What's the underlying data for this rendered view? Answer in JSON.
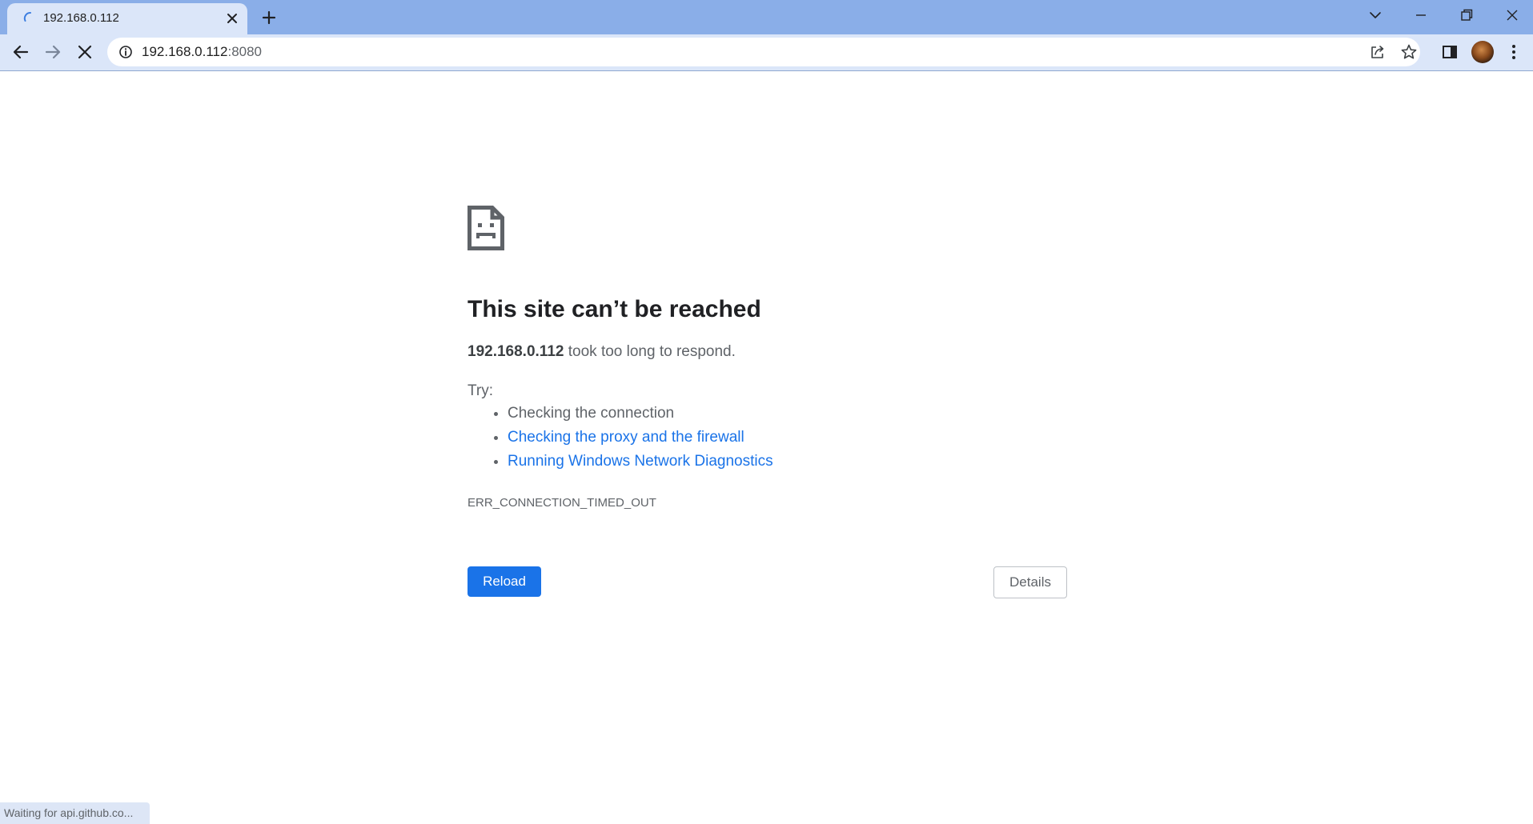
{
  "browser": {
    "tab": {
      "title": "192.168.0.112",
      "loading": true
    },
    "omnibox": {
      "host": "192.168.0.112",
      "port": ":8080"
    },
    "icons": {
      "tab_spinner": "loading-spinner-icon",
      "tab_close": "close-icon",
      "new_tab": "plus-icon",
      "tab_search": "chevron-down-icon",
      "minimize": "minimize-icon",
      "restore": "restore-icon",
      "close_window": "close-icon",
      "back": "arrow-left-icon",
      "forward": "arrow-right-icon",
      "stop": "stop-x-icon",
      "site_info": "info-icon",
      "share": "share-icon",
      "bookmark": "star-icon",
      "side_panel": "side-panel-icon",
      "menu": "kebab-menu-icon"
    },
    "colors": {
      "tabstrip": "#8aaee8",
      "toolbar": "#dbe6f9",
      "link": "#1a73e8",
      "button": "#1a73e8"
    }
  },
  "error_page": {
    "title": "This site can’t be reached",
    "host": "192.168.0.112",
    "message": " took too long to respond.",
    "try_label": "Try:",
    "suggestions": [
      "Checking the connection",
      "Checking the proxy and the firewall",
      "Running Windows Network Diagnostics"
    ],
    "error_code": "ERR_CONNECTION_TIMED_OUT",
    "reload_label": "Reload",
    "details_label": "Details"
  },
  "status_bar": {
    "text": "Waiting for api.github.co..."
  }
}
